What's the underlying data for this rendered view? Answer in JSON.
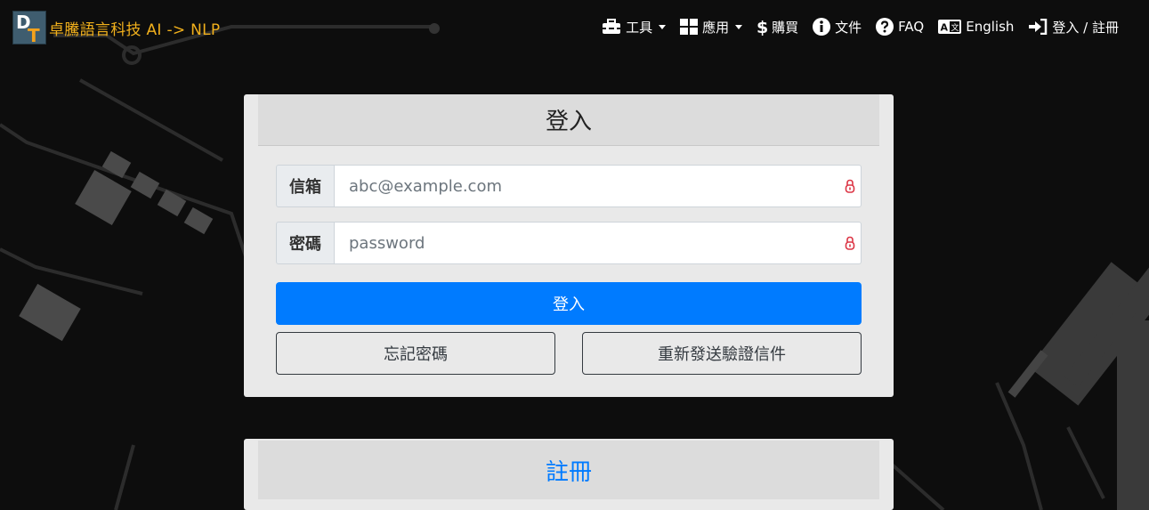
{
  "brand": {
    "logo_d": "D",
    "logo_t": "T",
    "name": "卓騰語言科技 AI -> NLP"
  },
  "nav": {
    "tools": "工具",
    "apps": "應用",
    "purchase": "購買",
    "docs": "文件",
    "faq": "FAQ",
    "language": "English",
    "login": "登入 / 註冊"
  },
  "login": {
    "title": "登入",
    "email_label": "信箱",
    "email_placeholder": "abc@example.com",
    "email_value": "",
    "password_label": "密碼",
    "password_placeholder": "password",
    "password_value": "",
    "submit": "登入",
    "forgot": "忘記密碼",
    "resend": "重新發送驗證信件"
  },
  "register": {
    "title": "註冊"
  },
  "colors": {
    "brand": "#f1b01c",
    "primary": "#007bff",
    "lock_icon": "#dc3545",
    "background": "#0d0d0d"
  },
  "icons": [
    "toolbox-icon",
    "grid-icon",
    "dollar-icon",
    "info-icon",
    "question-icon",
    "translate-icon",
    "sign-in-icon",
    "lock-icon"
  ]
}
